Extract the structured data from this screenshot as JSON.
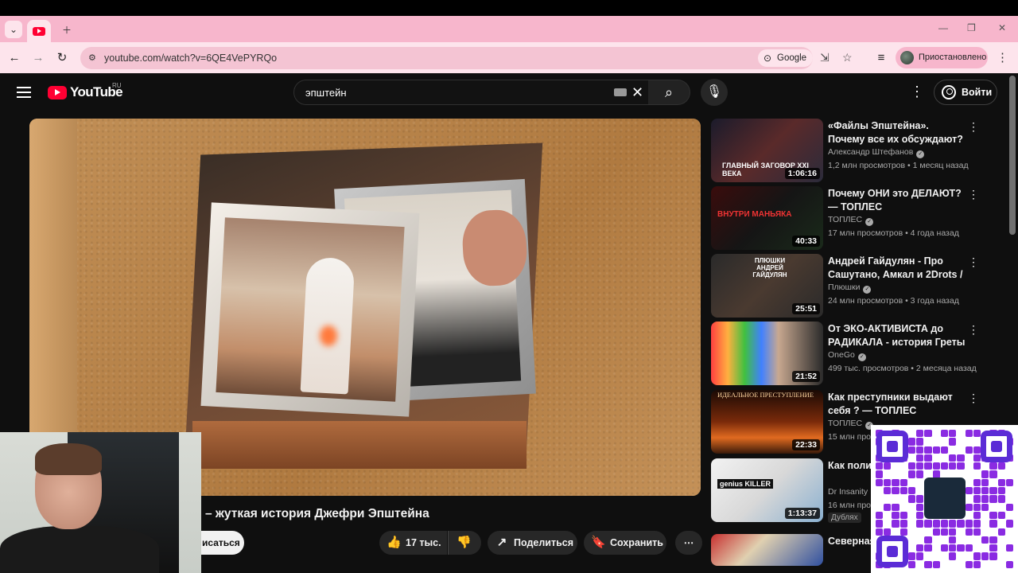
{
  "browser": {
    "url": "youtube.com/watch?v=6QE4VePYRQo",
    "google_label": "Google",
    "profile_label": "Приостановлено"
  },
  "youtube": {
    "logo_text": "YouTube",
    "region": "RU",
    "search_value": "эпштейн",
    "signin_label": "Войти"
  },
  "video": {
    "title_visible": "– жуткая история Джефри Эпштейна",
    "subscribe_label": "исаться",
    "like_count": "17 тыс.",
    "share_label": "Поделиться",
    "save_label": "Сохранить"
  },
  "recommendations": [
    {
      "title": "«Файлы Эпштейна». Почему все их обсуждают?",
      "channel": "Александр Штефанов",
      "verified": true,
      "meta": "1,2 млн просмотров • 1 месяц назад",
      "duration": "1:06:16",
      "thumb_text": "ГЛАВНЫЙ ЗАГОВОР XXI ВЕКА"
    },
    {
      "title": "Почему ОНИ это ДЕЛАЮТ? — ТОПЛЕС",
      "channel": "ТОПЛЕС",
      "verified": true,
      "meta": "17 млн просмотров • 4 года назад",
      "duration": "40:33",
      "thumb_text": "ВНУТРИ МАНЬЯКА"
    },
    {
      "title": "Андрей Гайдулян - Про Сашутано, Амкал и 2Drots / ...",
      "channel": "Плюшки",
      "verified": true,
      "meta": "24 млн просмотров • 3 года назад",
      "duration": "25:51",
      "thumb_text": "ПЛЮШКИ АНДРЕЙ ГАЙДУЛЯН"
    },
    {
      "title": "От ЭКО-АКТИВИСТА до РАДИКАЛА - история Греты ...",
      "channel": "OneGo",
      "verified": true,
      "meta": "499 тыс. просмотров • 2 месяца назад",
      "duration": "21:52",
      "thumb_text": ""
    },
    {
      "title": "Как преступники выдают себя ? — ТОПЛЕС",
      "channel": "ТОПЛЕС",
      "verified": true,
      "meta": "15 млн про",
      "duration": "22:33",
      "thumb_text": "ИДЕАЛЬНОЕ ПРЕСТУПЛЕНИЕ"
    },
    {
      "title": "Как полиц умного уб",
      "channel": "Dr Insanity",
      "verified": false,
      "meta": "16 млн про",
      "duration": "1:13:37",
      "thumb_text": "genius KILLER",
      "badge": "Дублях"
    },
    {
      "title": "Северная диктатур",
      "channel": "",
      "verified": false,
      "meta": "",
      "duration": "",
      "thumb_text": ""
    }
  ]
}
